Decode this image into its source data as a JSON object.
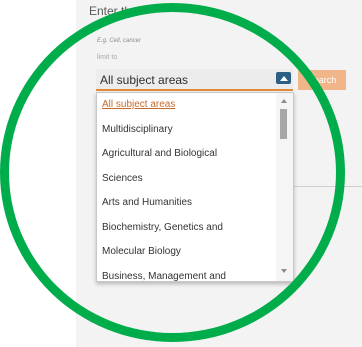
{
  "search_form": {
    "field_label": "Enter the",
    "hint": "E.g. Cell, cancer",
    "limit_label": "limit to",
    "subject_select": {
      "value": "All subject areas"
    },
    "search_button": "Search"
  },
  "dropdown": {
    "items": [
      "All subject areas",
      "Multidisciplinary",
      "Agricultural and Biological",
      "Sciences",
      "Arts and Humanities",
      "Biochemistry, Genetics and",
      "Molecular Biology",
      "Business, Management and"
    ],
    "selected_index": 0
  },
  "colors": {
    "ring": "#00ad4a",
    "accent_underline": "#e38a3c",
    "select_button": "#2b5f86",
    "search_button": "#f0b68a",
    "selected_item": "#c76b2a"
  },
  "icons": {
    "select_toggle": "caret-up-icon",
    "scroll_up": "scroll-up-arrow-icon",
    "scroll_down": "scroll-down-arrow-icon"
  }
}
